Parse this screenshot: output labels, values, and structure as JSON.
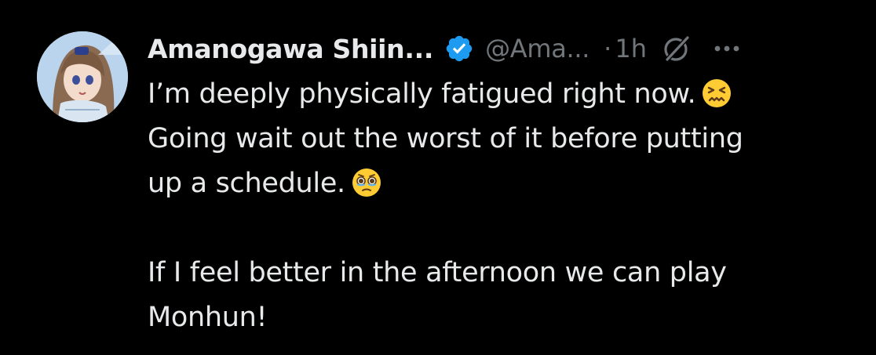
{
  "tweet": {
    "display_name": "Amanogawa Shiin...",
    "handle": "@Ama...",
    "separator": "·",
    "time": "1h",
    "icons": {
      "verified": "verified-badge-icon",
      "grok": "grok-icon",
      "more": "more-options-icon"
    },
    "body": {
      "line1": "I’m deeply physically fatigued right now.",
      "line1_emoji": "confounded-face-emoji",
      "line2": "Going wait out the worst of it before putting",
      "line3": "up a schedule.",
      "line3_emoji": "face-holding-back-tears-emoji",
      "line4": "If I feel better in the afternoon we can play",
      "line5": "Monhun!"
    }
  },
  "colors": {
    "background": "#000000",
    "primary_text": "#e7e9ea",
    "secondary_text": "#71767b",
    "verified_blue": "#1d9bf0",
    "emoji_yellow": "#ffcc33"
  }
}
